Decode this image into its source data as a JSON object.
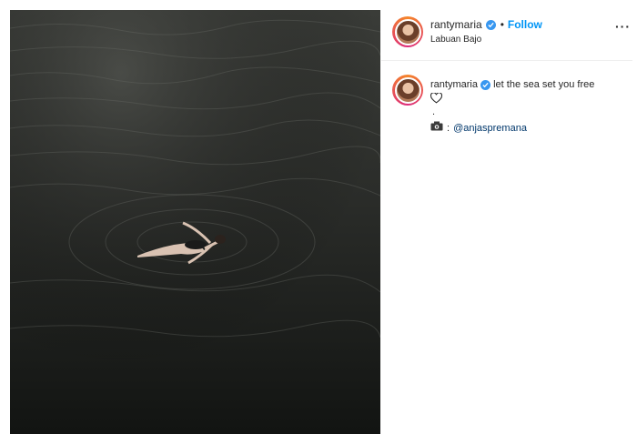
{
  "post": {
    "username": "rantymaria",
    "follow_label": "Follow",
    "separator": "•",
    "location": "Labuan Bajo",
    "more_label": "···"
  },
  "caption": {
    "username": "rantymaria",
    "text": "let the sea set you free",
    "dot": ".",
    "credit_suffix": ":",
    "mention": "@anjaspremana"
  },
  "colors": {
    "link_blue": "#0095f6",
    "verified_blue": "#3897f0",
    "mention": "#00376b",
    "water": "#1c1e1c"
  },
  "icons": {
    "verified": "verified-badge-icon",
    "heart": "heart-outline-icon",
    "camera": "camera-icon"
  }
}
